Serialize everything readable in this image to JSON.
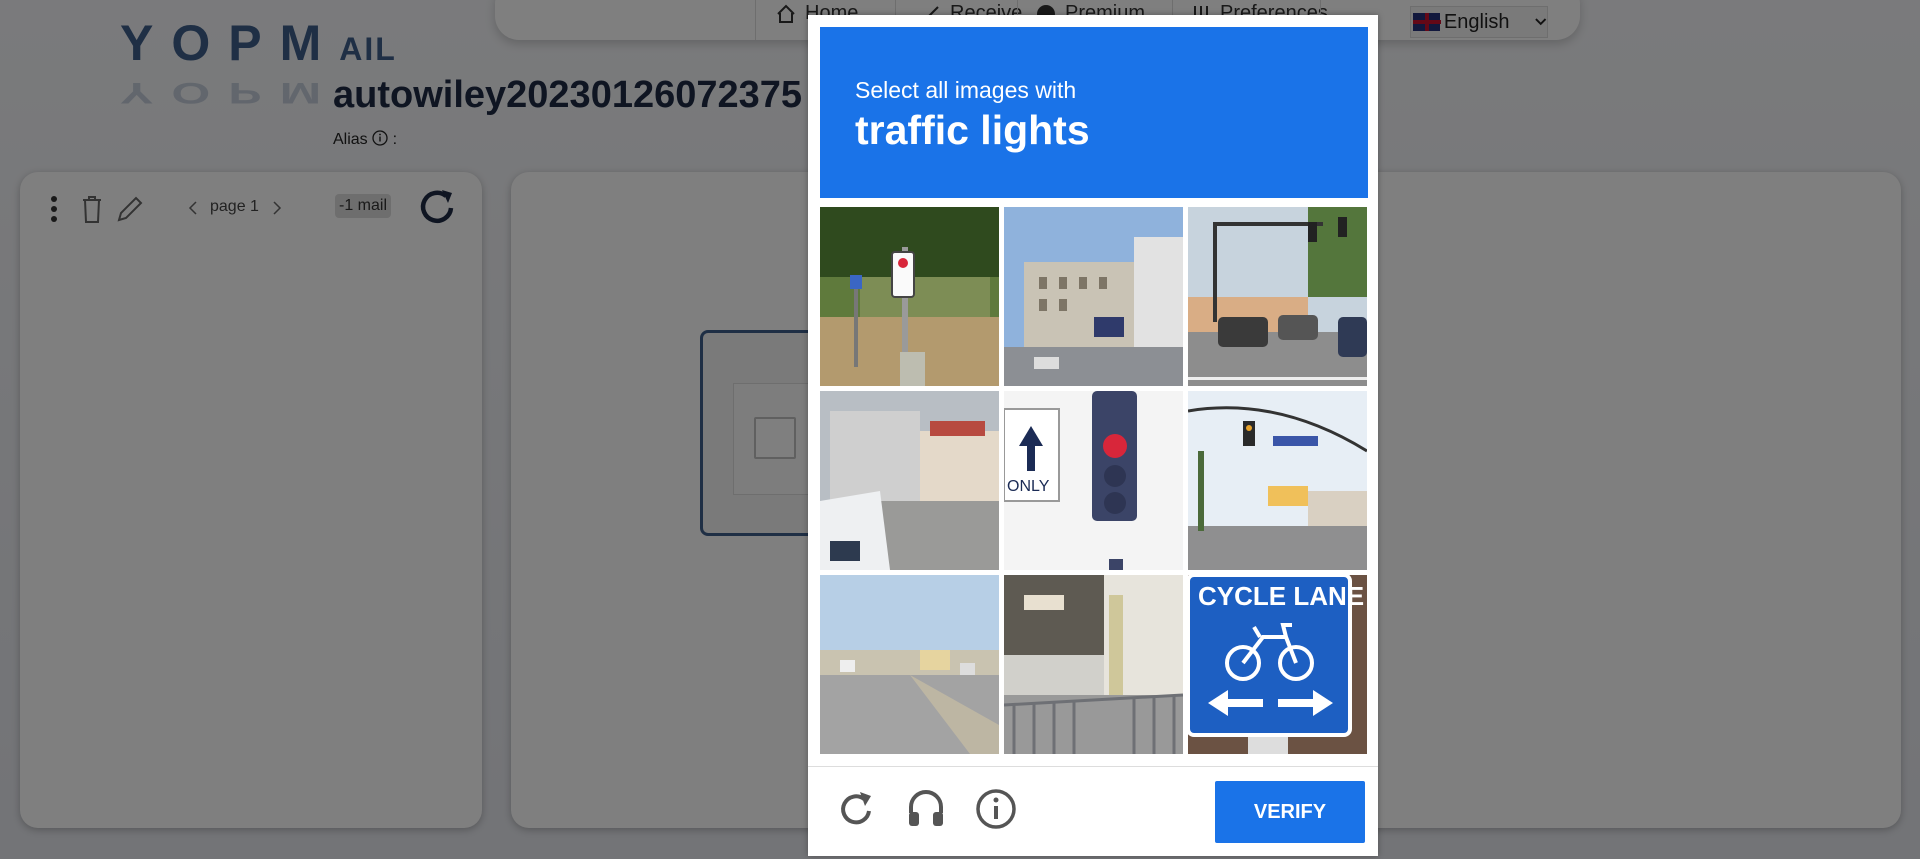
{
  "logo": {
    "main": "YOPM",
    "tail": "AIL"
  },
  "header": {
    "nav_items": [
      "Home",
      "Receive",
      "Premium",
      "Preferences"
    ],
    "language": "English"
  },
  "mailbox": {
    "title": "autowiley20230126072375",
    "alias_label": "Alias",
    "alias_colon": ":",
    "page_label": "page 1",
    "mail_count": "-1 mail"
  },
  "captcha": {
    "instruction": "Select all images with",
    "target": "traffic lights",
    "verify_label": "VERIFY",
    "tiles": [
      "traffic-light-street-corner",
      "city-street-buildings",
      "road-cars-trees",
      "street-van-buildings",
      "traffic-light-only-sign",
      "intersection-traffic-light",
      "road-bus-traffic",
      "sidewalk-fence-building",
      "cycle-lane-sign"
    ],
    "sign_text": "ONLY",
    "cycle_sign_text": "CYCLE LANE"
  },
  "colors": {
    "accent": "#1a73e8",
    "brand": "#3f5f8a"
  }
}
